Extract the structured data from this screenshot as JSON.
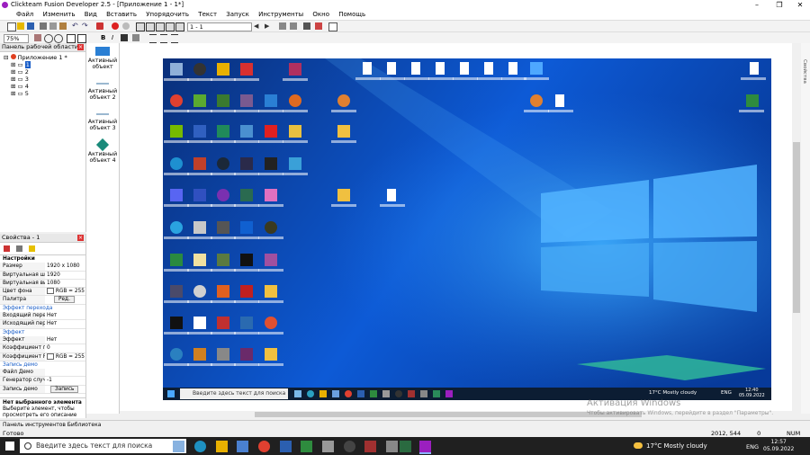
{
  "window": {
    "title": "Clickteam Fusion Developer 2.5 - [Приложение 1 - 1*]",
    "controls": [
      "–",
      "❐",
      "✕"
    ]
  },
  "menu": [
    "Файл",
    "Изменить",
    "Вид",
    "Вставить",
    "Упорядочить",
    "Текст",
    "Запуск",
    "Инструменты",
    "Окно",
    "Помощь"
  ],
  "toolbar": {
    "frame_combo": "1 - 1",
    "zoom": "75%"
  },
  "workspace": {
    "title": "Панель рабочей области",
    "root": "Приложение 1 *",
    "frames": [
      "1",
      "2",
      "3",
      "4",
      "5"
    ]
  },
  "properties": {
    "title": "Свойства - 1",
    "section": "Настройки",
    "rows": [
      {
        "key": "Размер",
        "value": "1920 x 1080"
      },
      {
        "key": "Виртуальная шир",
        "value": "1920"
      },
      {
        "key": "Виртуальная выс",
        "value": "1080"
      },
      {
        "key": "Цвет фона",
        "value": "RGB = 255"
      },
      {
        "key": "Палитра",
        "value": "Ред."
      }
    ],
    "cat_transition": "Эффект перехода",
    "rows2": [
      {
        "key": "Входящий перех",
        "value": "Нет"
      },
      {
        "key": "Исходящий перех",
        "value": "Нет"
      }
    ],
    "cat_effect": "Эффект",
    "rows3": [
      {
        "key": "Эффект",
        "value": "Нет"
      },
      {
        "key": "Коэффициент пр",
        "value": "0"
      },
      {
        "key": "Коэффициент RG",
        "value": "RGB = 255"
      }
    ],
    "cat_demo": "Запись демо",
    "rows4": [
      {
        "key": "Файл Демо",
        "value": ""
      },
      {
        "key": "Генератор случа",
        "value": "-1"
      },
      {
        "key": "Запись демо",
        "value": "Запись"
      }
    ],
    "info_title": "Нет выбранного элемента",
    "info_text": "Выберите элемент, чтобы просмотреть его описание"
  },
  "library": {
    "objects": [
      {
        "label": "Активный объект",
        "color": "#2a7fd4"
      },
      {
        "label": "Активный объект 2",
        "color": "#9bb8d0"
      },
      {
        "label": "Активный объект 3",
        "color": "#9bb8d0"
      },
      {
        "label": "Активный объект 4",
        "color": "#1a8a7a"
      }
    ]
  },
  "desktop_taskbar": {
    "search": "Введите здесь текст для поиска",
    "weather": "17°C  Mostly cloudy",
    "lang": "ENG",
    "time": "12:40",
    "date": "05.09.2022"
  },
  "activation": {
    "title": "Активация Windows",
    "sub": "Чтобы активировать Windows, перейдите в раздел \"Параметры\"."
  },
  "bottom_tabs": "Панель инструментов  Библиотека",
  "statusbar": {
    "left": "Готово",
    "right": "NUM",
    "coords": "2012, 544",
    "zero": "0"
  },
  "windows_taskbar": {
    "search": "Введите здесь текст для поиска",
    "weather": "17°C  Mostly cloudy",
    "lang": "ENG",
    "time": "12:57",
    "date": "05.09.2022"
  },
  "colors": {
    "desktop_dark": "#0a3a8c",
    "desktop_light": "#1e8fe8",
    "taskbar": "#202020",
    "accent": "#1a5ec8"
  }
}
